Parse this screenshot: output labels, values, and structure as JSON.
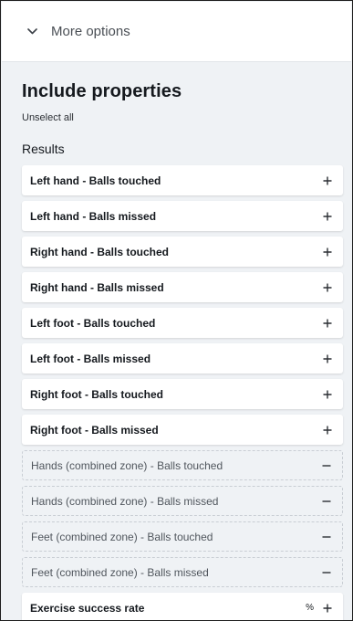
{
  "more_options": {
    "label": "More options",
    "icon": "chevron-down-icon"
  },
  "properties": {
    "heading": "Include properties",
    "unselect_label": "Unselect all",
    "section_label": "Results"
  },
  "items": [
    {
      "label": "Left hand - Balls touched",
      "selected": true,
      "action": "+"
    },
    {
      "label": "Left hand - Balls missed",
      "selected": true,
      "action": "+"
    },
    {
      "label": "Right hand - Balls touched",
      "selected": true,
      "action": "+"
    },
    {
      "label": "Right hand - Balls missed",
      "selected": true,
      "action": "+"
    },
    {
      "label": "Left foot - Balls touched",
      "selected": true,
      "action": "+"
    },
    {
      "label": "Left foot - Balls missed",
      "selected": true,
      "action": "+"
    },
    {
      "label": "Right foot - Balls touched",
      "selected": true,
      "action": "+"
    },
    {
      "label": "Right foot - Balls missed",
      "selected": true,
      "action": "+"
    },
    {
      "label": "Hands (combined zone) - Balls touched",
      "selected": false,
      "action": "−"
    },
    {
      "label": "Hands (combined zone) - Balls missed",
      "selected": false,
      "action": "−"
    },
    {
      "label": "Feet (combined zone) - Balls touched",
      "selected": false,
      "action": "−"
    },
    {
      "label": "Feet (combined zone) - Balls missed",
      "selected": false,
      "action": "−"
    },
    {
      "label": "Exercise success rate",
      "selected": true,
      "action": "+",
      "unit": "%"
    }
  ],
  "colors": {
    "panel_bg": "#eff2f5",
    "text": "#15191e",
    "muted_text": "#50565d"
  }
}
